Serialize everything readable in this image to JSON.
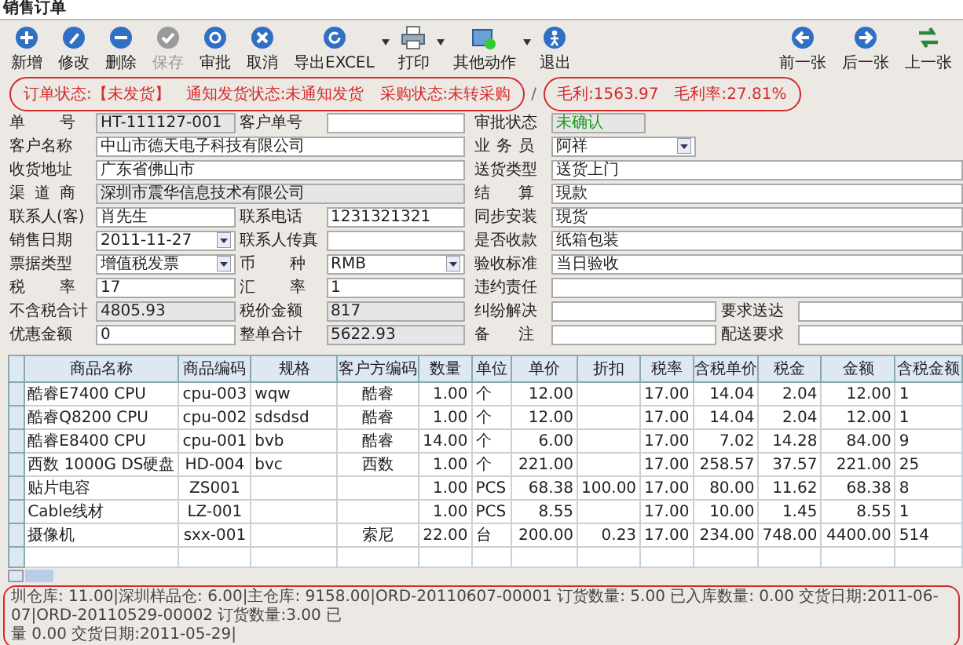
{
  "window": {
    "title": "销售订单"
  },
  "toolbar": {
    "left": [
      {
        "label": "新增",
        "disabled": false,
        "menu": false
      },
      {
        "label": "修改",
        "disabled": false,
        "menu": false
      },
      {
        "label": "删除",
        "disabled": false,
        "menu": false
      },
      {
        "label": "保存",
        "disabled": true,
        "menu": false
      },
      {
        "label": "审批",
        "disabled": false,
        "menu": false
      },
      {
        "label": "取消",
        "disabled": false,
        "menu": false
      },
      {
        "label": "导出EXCEL",
        "disabled": false,
        "menu": true
      },
      {
        "label": "打印",
        "disabled": false,
        "menu": true
      },
      {
        "label": "其他动作",
        "disabled": false,
        "menu": true
      },
      {
        "label": "退出",
        "disabled": false,
        "menu": false
      }
    ],
    "right": [
      {
        "label": "前一张",
        "disabled": false,
        "menu": false
      },
      {
        "label": "后一张",
        "disabled": false,
        "menu": false
      },
      {
        "label": "上一张",
        "disabled": false,
        "menu": false
      }
    ]
  },
  "status": {
    "order": [
      "订单状态:【未发货】",
      "通知发货状态:未通知发货",
      "采购状态:未转采购"
    ],
    "separator": "/",
    "profit": [
      "毛利:1563.97",
      "毛利率:27.81%"
    ]
  },
  "form": {
    "left_rows": [
      [
        {
          "label": "单号",
          "kind": "readonly",
          "value": "HT-111127-001"
        },
        {
          "label": "客户单号",
          "kind": "text"
        }
      ],
      [
        {
          "label": "客户名称",
          "kind": "text",
          "value": "中山市德天电子科技有限公司"
        }
      ],
      [
        {
          "label": "收货地址",
          "kind": "text",
          "value": "广东省佛山市"
        }
      ],
      [
        {
          "label": "渠道商",
          "kind": "readonly",
          "value": "深圳市震华信息技术有限公司"
        }
      ],
      [
        {
          "label": "联系人(客)",
          "kind": "text",
          "value": "肖先生"
        },
        {
          "label": "联系电话",
          "kind": "text",
          "value": "1231321321"
        }
      ],
      [
        {
          "label": "销售日期",
          "kind": "date",
          "value": "2011-11-27"
        },
        {
          "label": "联系人传真",
          "kind": "text"
        }
      ],
      [
        {
          "label": "票据类型",
          "kind": "select",
          "value": "增值税发票"
        },
        {
          "label": "币种",
          "kind": "select",
          "value": "RMB"
        }
      ],
      [
        {
          "label": "税率",
          "kind": "text",
          "value": "17"
        },
        {
          "label": "汇率",
          "kind": "text",
          "value": "1"
        }
      ],
      [
        {
          "label": "不含税合计",
          "kind": "readonly",
          "value": "4805.93"
        },
        {
          "label": "税价金额",
          "kind": "readonly",
          "value": "817"
        }
      ],
      [
        {
          "label": "优惠金额",
          "kind": "text",
          "value": "0"
        },
        {
          "label": "整单合计",
          "kind": "readonly",
          "value": "5622.93"
        }
      ]
    ],
    "right_rows": [
      [
        {
          "label": "审批状态",
          "kind": "status",
          "value": "未确认"
        }
      ],
      [
        {
          "label": "业务员",
          "kind": "select",
          "value": "阿祥"
        }
      ],
      [
        {
          "label": "送货类型",
          "kind": "text",
          "value": "送货上门"
        }
      ],
      [
        {
          "label": "结算",
          "kind": "text",
          "value": "現款"
        }
      ],
      [
        {
          "label": "同步安装",
          "kind": "text",
          "value": "現货"
        }
      ],
      [
        {
          "label": "是否收款",
          "kind": "text",
          "value": "纸箱包装"
        }
      ],
      [
        {
          "label": "验收标准",
          "kind": "text",
          "value": "当日验收"
        }
      ],
      [
        {
          "label": "违约责任",
          "kind": "text"
        }
      ],
      [
        {
          "label": "纠纷解决",
          "kind": "text"
        },
        {
          "label": "要求送达",
          "kind": "text"
        }
      ],
      [
        {
          "label": "备注",
          "kind": "text"
        },
        {
          "label": "配送要求",
          "kind": "text"
        }
      ]
    ]
  },
  "table": {
    "columns": [
      "商品名称",
      "商品编码",
      "规格",
      "客户方编码",
      "数量",
      "单位",
      "单价",
      "折扣",
      "税率",
      "含税单价",
      "税金",
      "金额",
      "含税金额"
    ],
    "rows": [
      [
        "酷睿E7400 CPU",
        "cpu-003",
        "wqw",
        "酷睿",
        "1.00",
        "个",
        "12.00",
        "",
        "17.00",
        "14.04",
        "2.04",
        "12.00",
        "1"
      ],
      [
        "酷睿Q8200 CPU",
        "cpu-002",
        "sdsdsd",
        "酷睿",
        "1.00",
        "个",
        "12.00",
        "",
        "17.00",
        "14.04",
        "2.04",
        "12.00",
        "1"
      ],
      [
        "酷睿E8400 CPU",
        "cpu-001",
        "bvb",
        "酷睿",
        "14.00",
        "个",
        "6.00",
        "",
        "17.00",
        "7.02",
        "14.28",
        "84.00",
        "9"
      ],
      [
        "西数 1000G DS硬盘",
        "HD-004",
        "bvc",
        "西数",
        "1.00",
        "个",
        "221.00",
        "",
        "17.00",
        "258.57",
        "37.57",
        "221.00",
        "25"
      ],
      [
        "贴片电容",
        "ZS001",
        "",
        "",
        "1.00",
        "PCS",
        "68.38",
        "100.00",
        "17.00",
        "80.00",
        "11.62",
        "68.38",
        "8"
      ],
      [
        "Cable线材",
        "LZ-001",
        "",
        "",
        "1.00",
        "PCS",
        "8.55",
        "",
        "17.00",
        "10.00",
        "1.45",
        "8.55",
        "1"
      ],
      [
        "摄像机",
        "sxx-001",
        "",
        "索尼",
        "22.00",
        "台",
        "200.00",
        "0.23",
        "17.00",
        "234.00",
        "748.00",
        "4400.00",
        "514"
      ]
    ]
  },
  "footer": {
    "text": "圳仓库: 11.00|深圳样品仓: 6.00|主仓库: 9158.00|ORD-20110607-00001 订货数量: 5.00  已入库数量: 0.00  交货日期:2011-06-07|ORD-20110529-00002 订货数量:3.00  已",
    "text_2": "量 0.00  交货日期:2011-05-29|"
  }
}
